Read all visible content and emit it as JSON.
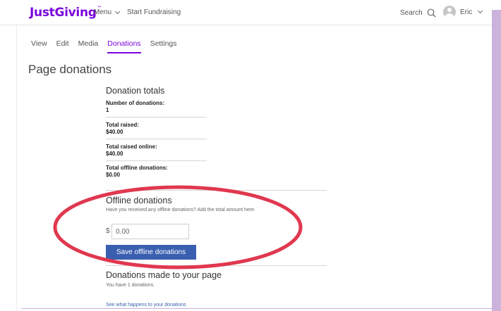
{
  "header": {
    "logo_text": "JustGiving",
    "logo_mark": "™",
    "menu_label": "Menu",
    "start_label": "Start Fundraising",
    "search_label": "Search",
    "user_name": "Eric"
  },
  "tabs": [
    {
      "label": "View",
      "active": false
    },
    {
      "label": "Edit",
      "active": false
    },
    {
      "label": "Media",
      "active": false
    },
    {
      "label": "Donations",
      "active": true
    },
    {
      "label": "Settings",
      "active": false
    }
  ],
  "page": {
    "title": "Page donations"
  },
  "totals": {
    "title": "Donation totals",
    "stats": [
      {
        "label": "Number of donations:",
        "value": "1"
      },
      {
        "label": "Total raised:",
        "value": "$40.00"
      },
      {
        "label": "Total raised online:",
        "value": "$40.00"
      },
      {
        "label": "Total offline donations:",
        "value": "$0.00"
      }
    ]
  },
  "offline": {
    "title": "Offline donations",
    "hint": "Have you received any offline donations? Add the total amount here.",
    "currency": "$",
    "amount_value": "0.00",
    "save_label": "Save offline donations"
  },
  "made": {
    "title": "Donations made to your page",
    "subtitle": "You have 1 donations.",
    "link_label": "See what happens to your donations"
  },
  "colors": {
    "brand": "#7a04dd",
    "button": "#3a5fb0",
    "annotation": "#e0384f"
  }
}
